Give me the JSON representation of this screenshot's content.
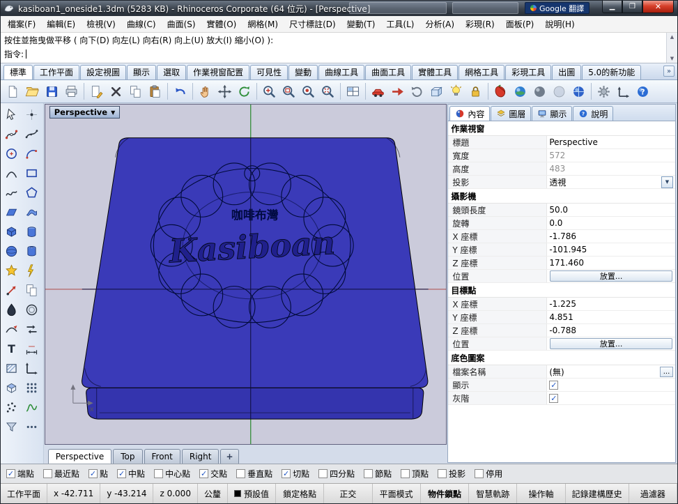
{
  "window": {
    "title": "kasiboan1_oneside1.3dm (5283 KB) - Rhinoceros Corporate (64 位元) - [Perspective]",
    "overlay_text": "Google 翻譯"
  },
  "menu": {
    "items": [
      "檔案(F)",
      "編輯(E)",
      "檢視(V)",
      "曲線(C)",
      "曲面(S)",
      "實體(O)",
      "網格(M)",
      "尺寸標註(D)",
      "變動(T)",
      "工具(L)",
      "分析(A)",
      "彩現(R)",
      "面板(P)",
      "說明(H)"
    ]
  },
  "command": {
    "history": "按住並拖曳做平移 ( 向下(D) 向左(L) 向右(R) 向上(U) 放大(I) 縮小(O) ):",
    "prompt": "指令:"
  },
  "toolbar_tabs": {
    "active": "標準",
    "items": [
      "標準",
      "工作平面",
      "設定視圖",
      "顯示",
      "選取",
      "作業視窗配置",
      "可見性",
      "變動",
      "曲線工具",
      "曲面工具",
      "實體工具",
      "網格工具",
      "彩現工具",
      "出圖",
      "5.0的新功能"
    ]
  },
  "toolbar": {
    "icons": [
      "new-file",
      "open-file",
      "save",
      "print",
      "edit-page",
      "delete",
      "copy",
      "paste",
      "undo",
      "pan",
      "move-view",
      "rotate-view",
      "zoom-dynamic",
      "zoom-window",
      "zoom-selected",
      "zoom-extents",
      "viewport-layout",
      "named-views",
      "set-view",
      "undo-view",
      "cplane",
      "light",
      "lock",
      "render",
      "render-preview",
      "shade-mode",
      "ghosted-mode",
      "display-globe",
      "options",
      "axes",
      "help"
    ]
  },
  "sidebar": {
    "icons": [
      "select",
      "single-point",
      "curve-control-points",
      "curve-interpolate",
      "circle-center",
      "arc-center",
      "conic",
      "rectangle",
      "freeform-curve",
      "polygon",
      "plane-surface",
      "loft-surface",
      "solid-box",
      "solid-cylinder",
      "solid-sphere",
      "solid-tube",
      "fillet",
      "explode",
      "move",
      "copy",
      "boolean-difference",
      "offset",
      "extract-isocurve",
      "flip-direction",
      "text-object",
      "dimension",
      "hatch",
      "cplane-axes",
      "block-insert",
      "array",
      "point-cloud",
      "analyze-curve",
      "filter",
      "more-tools"
    ]
  },
  "viewport": {
    "label": "Perspective",
    "emblem_text_cn": "咖啡布灣",
    "emblem_text_en": "Kasiboan"
  },
  "viewport_tabs": {
    "active": "Perspective",
    "items": [
      "Perspective",
      "Top",
      "Front",
      "Right"
    ]
  },
  "panel": {
    "active_tab": "內容",
    "tabs": [
      {
        "id": "properties",
        "label": "內容"
      },
      {
        "id": "layers",
        "label": "圖層"
      },
      {
        "id": "display",
        "label": "顯示"
      },
      {
        "id": "help",
        "label": "說明"
      }
    ],
    "sections": [
      {
        "title": "作業視窗",
        "rows": [
          {
            "label": "標題",
            "value": "Perspective"
          },
          {
            "label": "寬度",
            "value": "572",
            "muted": true
          },
          {
            "label": "高度",
            "value": "483",
            "muted": true
          },
          {
            "label": "投影",
            "value": "透視",
            "control": "dropdown"
          }
        ]
      },
      {
        "title": "攝影機",
        "rows": [
          {
            "label": "鏡頭長度",
            "value": "50.0"
          },
          {
            "label": "旋轉",
            "value": "0.0"
          },
          {
            "label": "X 座標",
            "value": "-1.786"
          },
          {
            "label": "Y 座標",
            "value": "-101.945"
          },
          {
            "label": "Z 座標",
            "value": "171.460"
          },
          {
            "label": "位置",
            "value": "放置...",
            "control": "button"
          }
        ]
      },
      {
        "title": "目標點",
        "rows": [
          {
            "label": "X 座標",
            "value": "-1.225"
          },
          {
            "label": "Y 座標",
            "value": "4.851"
          },
          {
            "label": "Z 座標",
            "value": "-0.788"
          },
          {
            "label": "位置",
            "value": "放置...",
            "control": "button"
          }
        ]
      },
      {
        "title": "底色圖案",
        "rows": [
          {
            "label": "檔案名稱",
            "value": "(無)",
            "control": "file"
          },
          {
            "label": "顯示",
            "control": "checkbox",
            "checked": true
          },
          {
            "label": "灰階",
            "control": "checkbox",
            "checked": true
          }
        ]
      }
    ]
  },
  "osnap": {
    "items": [
      {
        "label": "端點",
        "checked": true
      },
      {
        "label": "最近點",
        "checked": false
      },
      {
        "label": "點",
        "checked": true
      },
      {
        "label": "中點",
        "checked": true
      },
      {
        "label": "中心點",
        "checked": false
      },
      {
        "label": "交點",
        "checked": true
      },
      {
        "label": "垂直點",
        "checked": false
      },
      {
        "label": "切點",
        "checked": true
      },
      {
        "label": "四分點",
        "checked": false
      },
      {
        "label": "節點",
        "checked": false
      },
      {
        "label": "頂點",
        "checked": false
      },
      {
        "label": "投影",
        "checked": false
      },
      {
        "label": "停用",
        "checked": false
      }
    ]
  },
  "statusbar": {
    "items": [
      {
        "label": "工作平面"
      },
      {
        "label": "x -42.711"
      },
      {
        "label": "y -43.214"
      },
      {
        "label": "z 0.000"
      },
      {
        "label": "公釐"
      },
      {
        "label": "預設值",
        "swatch": "#000000"
      },
      {
        "label": "鎖定格點",
        "button": true
      },
      {
        "label": "正交",
        "button": true
      },
      {
        "label": "平面模式",
        "button": true
      },
      {
        "label": "物件鎖點",
        "button": true,
        "bold": true
      },
      {
        "label": "智慧軌跡",
        "button": true
      },
      {
        "label": "操作軸",
        "button": true
      },
      {
        "label": "記錄建構歷史",
        "button": true
      },
      {
        "label": "過濾器",
        "button": true
      }
    ]
  },
  "colors": {
    "object_blue_top": "#3a3ab8",
    "object_blue_front": "#3434ae",
    "viewport_bg": "#cbcbdb",
    "axis_green": "#27862a",
    "axis_red": "#b05a5a",
    "close_button_red": "#d6402b"
  }
}
